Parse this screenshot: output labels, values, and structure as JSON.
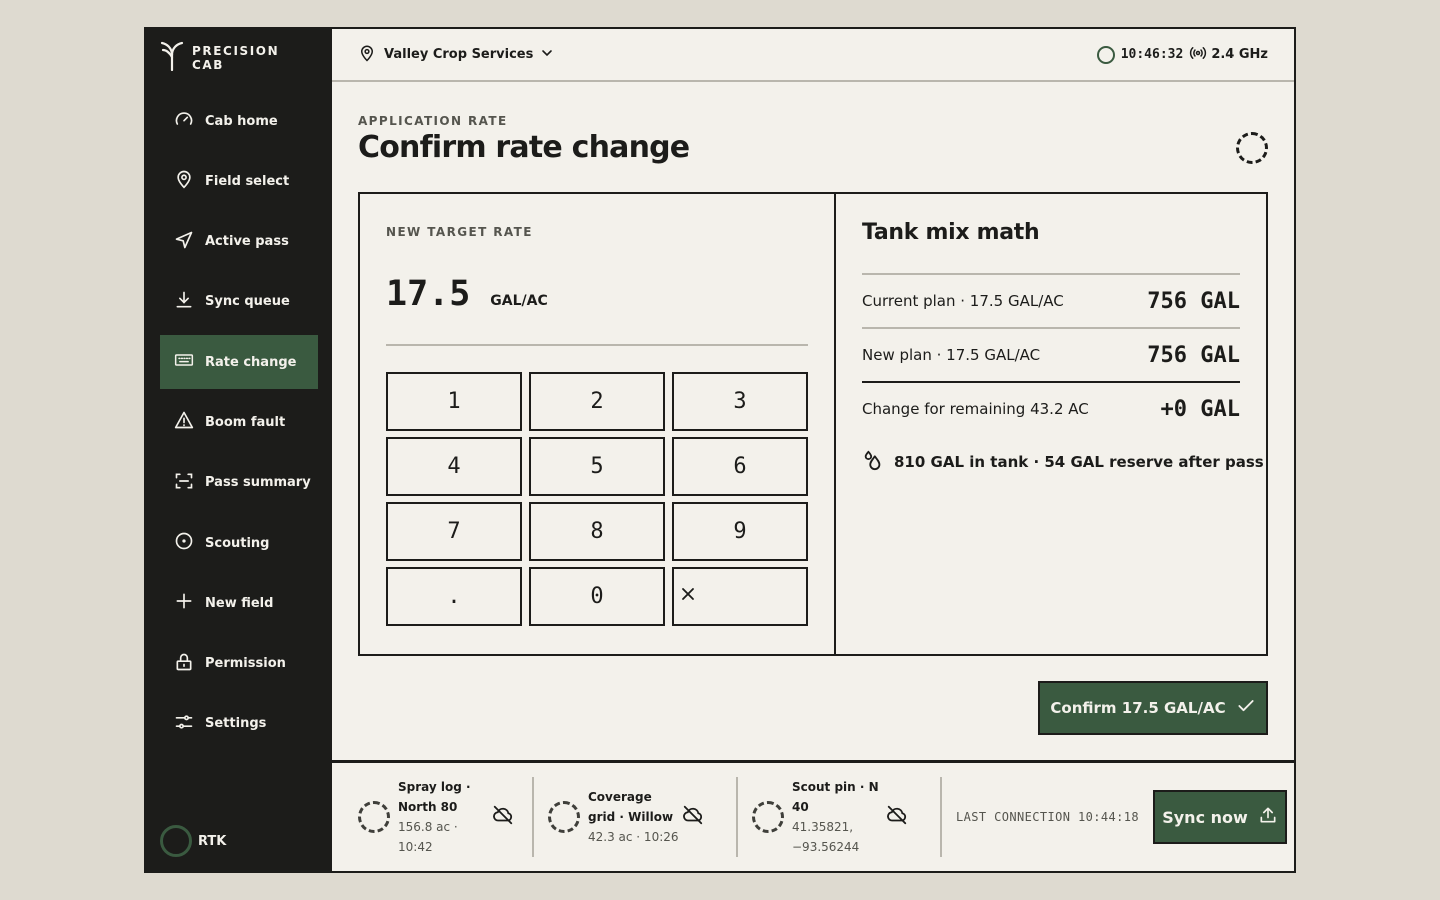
{
  "brand": {
    "line1": "PRECISION",
    "line2": "CAB"
  },
  "sidebar": {
    "items": [
      {
        "label": "Cab home",
        "icon": "gauge-icon"
      },
      {
        "label": "Field select",
        "icon": "map-pin-icon"
      },
      {
        "label": "Active pass",
        "icon": "navigation-icon"
      },
      {
        "label": "Sync queue",
        "icon": "download-icon"
      },
      {
        "label": "Rate change",
        "icon": "keyboard-icon",
        "active": true
      },
      {
        "label": "Boom fault",
        "icon": "warning-icon"
      },
      {
        "label": "Pass summary",
        "icon": "scan-icon"
      },
      {
        "label": "Scouting",
        "icon": "target-icon"
      },
      {
        "label": "New field",
        "icon": "plus-icon"
      },
      {
        "label": "Permission",
        "icon": "lock-icon"
      },
      {
        "label": "Settings",
        "icon": "sliders-icon"
      }
    ],
    "rtk_label": "RTK"
  },
  "topbar": {
    "org_name": "Valley Crop Services",
    "clock": "10:46:32",
    "signal": "2.4 GHz"
  },
  "page": {
    "eyebrow": "APPLICATION RATE",
    "title": "Confirm rate change"
  },
  "entry": {
    "label": "NEW TARGET RATE",
    "value": "17.5",
    "unit": "GAL/AC",
    "keys": [
      "1",
      "2",
      "3",
      "4",
      "5",
      "6",
      "7",
      "8",
      "9",
      ".",
      "0"
    ]
  },
  "math": {
    "title": "Tank mix math",
    "rows": [
      {
        "label": "Current plan · 17.5 GAL/AC",
        "value": "756 GAL"
      },
      {
        "label": "New plan · 17.5 GAL/AC",
        "value": "756 GAL"
      },
      {
        "label": "Change for remaining 43.2 AC",
        "value": "+0 GAL"
      }
    ],
    "tank_note": "810 GAL in tank · 54 GAL reserve after pass"
  },
  "confirm_label": "Confirm 17.5 GAL/AC",
  "footer": {
    "items": [
      {
        "title": "Spray log · North 80",
        "meta": "156.8 ac · 10:42"
      },
      {
        "title": "Coverage grid · Willow",
        "meta": "42.3 ac · 10:26"
      },
      {
        "title": "Scout pin · N 40",
        "meta": "41.35821, −93.56244"
      }
    ],
    "last_connection": "LAST CONNECTION 10:44:18",
    "sync_label": "Sync now"
  },
  "colors": {
    "accent": "#3a5a40",
    "ink": "#1c1c1a",
    "paper": "#f3f1eb",
    "backdrop": "#dedad0"
  }
}
